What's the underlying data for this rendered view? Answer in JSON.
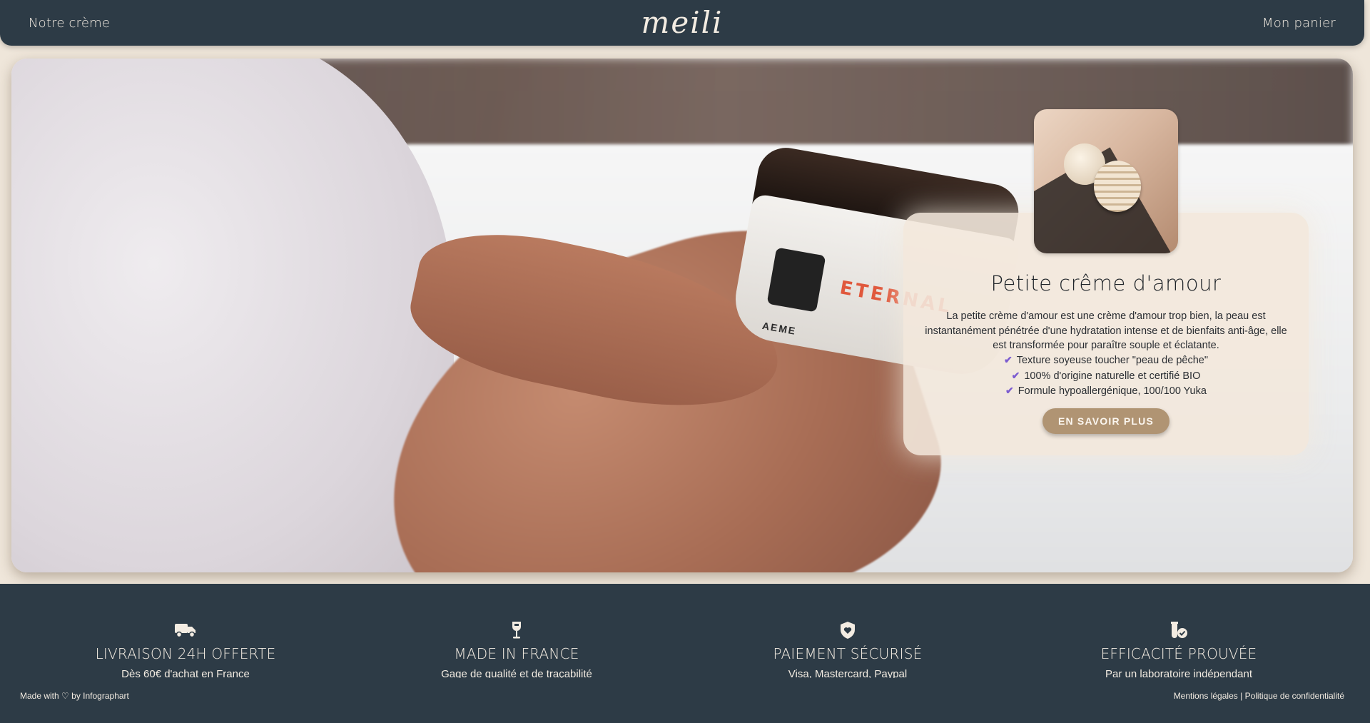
{
  "header": {
    "nav_left": "Notre crème",
    "logo": "meili",
    "nav_right": "Mon panier"
  },
  "hero": {
    "jar_text": "ETERNAL",
    "jar_brand": "AEME"
  },
  "product": {
    "title": "Petite crême d'amour",
    "description": "La petite crème d'amour est une crème d'amour trop bien, la peau est instantanément pénétrée d'une hydratation intense et de bienfaits anti-âge, elle est transformée pour paraître souple et éclatante.",
    "features": [
      "Texture soyeuse toucher \"peau de pêche\"",
      "100% d'origine naturelle et certifié BIO",
      "Formule hypoallergénique, 100/100 Yuka"
    ],
    "cta_label": "EN SAVOIR PLUS"
  },
  "footer": {
    "features": [
      {
        "icon": "truck-icon",
        "title": "LIVRAISON 24H OFFERTE",
        "subtitle": "Dès 60€ d'achat en France"
      },
      {
        "icon": "wine-glass-icon",
        "title": "MADE IN FRANCE",
        "subtitle": "Gage de qualité et de traçabilité"
      },
      {
        "icon": "shield-heart-icon",
        "title": "PAIEMENT SÉCURISÉ",
        "subtitle": "Visa, Mastercard, Paypal"
      },
      {
        "icon": "lab-check-icon",
        "title": "EFFICACITÉ PROUVÉE",
        "subtitle": "Par un laboratoire indépendant"
      }
    ],
    "made_with_prefix": "Made with",
    "made_with_suffix": "by Infographart",
    "legal_link": "Mentions légales",
    "legal_separator": "|",
    "privacy_link": "Politique de confidentialité"
  },
  "colors": {
    "header_bg": "#2d3b46",
    "page_bg": "#efe6da",
    "card_bg": "#f3e8db",
    "cta_bg": "#b09473",
    "check_color": "#7b5bd0"
  }
}
